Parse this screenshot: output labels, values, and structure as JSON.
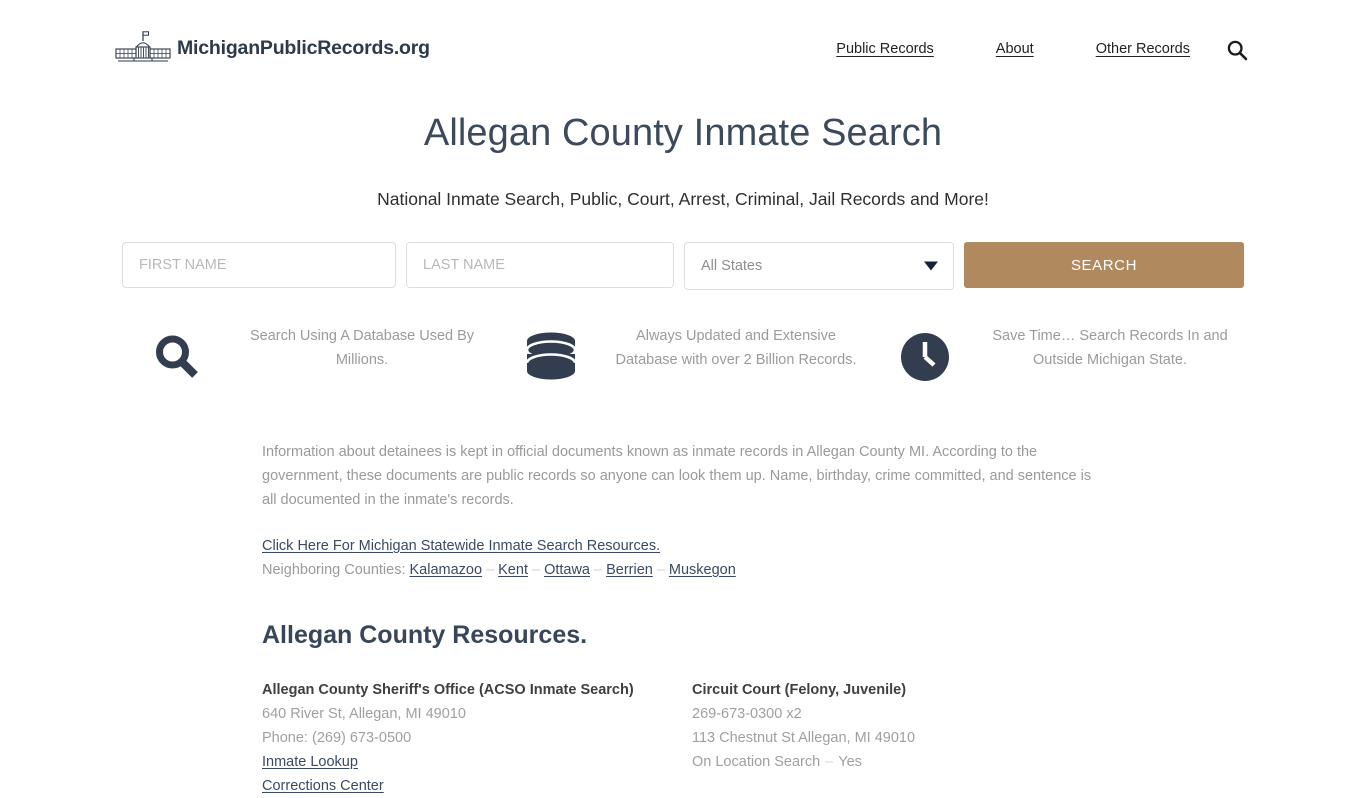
{
  "header": {
    "logo_icon": "capitol-building-icon",
    "logo_text": "MichiganPublicRecords.org",
    "nav": [
      {
        "label": "Public Records"
      },
      {
        "label": "About"
      },
      {
        "label": "Other Records"
      }
    ],
    "search_icon": "search-icon"
  },
  "hero": {
    "title": "Allegan County Inmate Search",
    "subtitle": "National Inmate Search, Public, Court, Arrest, Criminal, Jail Records and More!"
  },
  "search_form": {
    "first_name_placeholder": "FIRST NAME",
    "first_name_value": "",
    "last_name_placeholder": "LAST NAME",
    "last_name_value": "",
    "state_selected": "All States",
    "state_options": [
      "All States"
    ],
    "submit_label": "SEARCH",
    "submit_color": "#b08a5e"
  },
  "features": [
    {
      "icon": "magnifier-icon",
      "text": "Search Using A Database Used By Millions."
    },
    {
      "icon": "database-icon",
      "text": "Always Updated and Extensive Database with over 2 Billion Records."
    },
    {
      "icon": "clock-icon",
      "text": "Save Time… Search Records In and Outside Michigan State."
    }
  ],
  "content": {
    "intro": "Information about detainees is kept in official documents known as inmate records in Allegan County MI. According to the government, these documents are public records so anyone can look them up. Name, birthday, crime committed, and sentence is all documented in the inmate's records.",
    "statewide_link": "Click Here For Michigan Statewide Inmate Search Resources.",
    "neighbors_label": "Neighboring Counties:",
    "neighbors": [
      "Kalamazoo",
      "Kent",
      "Ottawa",
      "Berrien",
      "Muskegon"
    ],
    "section_heading": "Allegan County Resources."
  },
  "resources": {
    "left": {
      "title": "Allegan County Sheriff's Office (ACSO Inmate Search)",
      "address": "640 River St, Allegan, MI 49010",
      "phone": "Phone: (269) 673-0500",
      "link1": "Inmate Lookup",
      "link2": "Corrections Center"
    },
    "right": {
      "title": "Circuit Court (Felony, Juvenile)",
      "phone": "269-673-0300 x2",
      "address": "113 Chestnut St Allegan, MI 49010",
      "onsite_label": "On Location Search",
      "onsite_value": "Yes"
    }
  },
  "colors": {
    "accent": "#b08a5e",
    "heading": "#38455a",
    "link": "#3a4a63",
    "body_text": "#9a9a9a"
  }
}
